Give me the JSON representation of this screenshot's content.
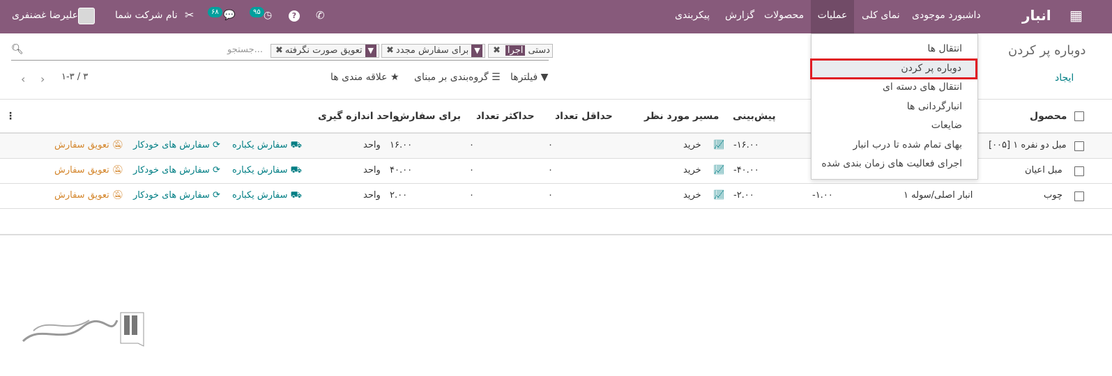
{
  "topbar": {
    "app_name": "انبار",
    "menus": [
      "داشبورد موجودی",
      "نمای کلی",
      "عملیات",
      "محصولات",
      "گزارش",
      "پیکربندی"
    ],
    "user_name": "علیرضا غضنفری",
    "company_name": "نام شرکت شما",
    "chat_count": "۶۸",
    "activity_count": "۹۵"
  },
  "operations_menu": {
    "items": [
      "انتقال ها",
      "دوباره پر کردن",
      "انتقال های دسته ای",
      "انبارگردانی ها",
      "ضایعات",
      "بهای تمام شده تا درب انبار",
      "اجرای فعالیت های زمان بندی شده"
    ]
  },
  "page": {
    "title": "دوباره پر کردن",
    "create_label": "ایجاد"
  },
  "search": {
    "placeholder": "جستجو...",
    "facets": [
      {
        "icon": "اجرا",
        "label": "دستی"
      },
      {
        "label": "برای سفارش مجدد"
      },
      {
        "label": "تعویق صورت نگرفته"
      }
    ]
  },
  "controls": {
    "filters": "فیلترها",
    "group_by": "گروه‌بندی بر مبنای",
    "favorites": "علاقه مندی ها",
    "pager": "۱-۳ / ۳"
  },
  "table": {
    "headers": {
      "product": "محصول",
      "location": "",
      "warehouse": "",
      "forecast": "پیش‌بینی",
      "route": "مسیر مورد نظر",
      "min_qty": "حداقل تعداد",
      "max_qty": "حداکثر تعداد",
      "to_order": "برای سفارش",
      "uom": "واحد اندازه گیری"
    },
    "rows": [
      {
        "product": "[۰۰۵] مبل دو نفره ۱",
        "location": "",
        "on_hand": "",
        "forecast": "-۱۶.۰۰",
        "route": "خرید",
        "min": "۰",
        "max": "۰",
        "to_order": "۱۶.۰۰",
        "uom": "واحد"
      },
      {
        "product": "مبل اعیان",
        "location": "",
        "on_hand": "",
        "forecast": "-۴۰.۰۰",
        "route": "خرید",
        "min": "۰",
        "max": "۰",
        "to_order": "۴۰.۰۰",
        "uom": "واحد"
      },
      {
        "product": "چوب",
        "location": "انبار اصلی/سوله ۱",
        "on_hand": "-۱.۰۰",
        "forecast": "-۲.۰۰",
        "route": "خرید",
        "min": "۰",
        "max": "۰",
        "to_order": "۲.۰۰",
        "uom": "واحد"
      }
    ],
    "actions": {
      "order_once": "سفارش یکباره",
      "automate": "سفارش های خودکار",
      "snooze": "تعویق سفارش"
    }
  },
  "colors": {
    "topbar": "#875a7b",
    "accent": "#017e84",
    "highlight_border": "#e01c24",
    "snooze": "#d4862c"
  }
}
